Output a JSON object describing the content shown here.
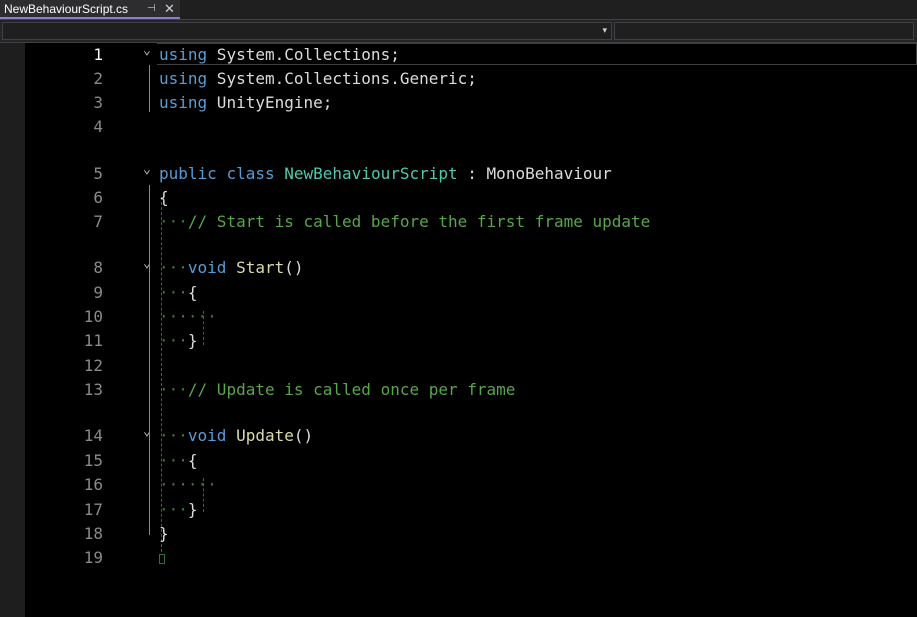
{
  "tab": {
    "title": "NewBehaviourScript.cs",
    "pin_glyph": "⊣",
    "close_glyph": "✕"
  },
  "navbar": {
    "chevron": "▾"
  },
  "fold_glyph": "⌄",
  "lines": [
    {
      "n": "1",
      "fold": true,
      "current": true
    },
    {
      "n": "2"
    },
    {
      "n": "3"
    },
    {
      "n": "4"
    },
    {
      "n": "5",
      "fold": true
    },
    {
      "n": "6"
    },
    {
      "n": "7"
    },
    {
      "n": "8",
      "fold": true
    },
    {
      "n": "9"
    },
    {
      "n": "10"
    },
    {
      "n": "11"
    },
    {
      "n": "12"
    },
    {
      "n": "13"
    },
    {
      "n": "14",
      "fold": true
    },
    {
      "n": "15"
    },
    {
      "n": "16"
    },
    {
      "n": "17"
    },
    {
      "n": "18"
    },
    {
      "n": "19"
    }
  ],
  "code": {
    "l1_kw": "using",
    "l1_rest": " System.Collections;",
    "l2_kw": "using",
    "l2_rest": " System.Collections.Generic;",
    "l3_kw": "using",
    "l3_rest": " UnityEngine;",
    "l5_kw1": "public",
    "l5_kw2": "class",
    "l5_cls": "NewBehaviourScript",
    "l5_colon": " : ",
    "l5_base": "MonoBehaviour",
    "l6": "{",
    "l7_ws": "···",
    "l7_cmt": "// Start is called before the first frame update",
    "l8_ws": "···",
    "l8_kw": "void",
    "l8_fn": " Start",
    "l8_paren": "()",
    "l9_ws": "···",
    "l9_brace": "{",
    "l10_ws": "······",
    "l11_ws": "···",
    "l11_brace": "}",
    "l13_ws": "···",
    "l13_cmt": "// Update is called once per frame",
    "l14_ws": "···",
    "l14_kw": "void",
    "l14_fn": " Update",
    "l14_paren": "()",
    "l15_ws": "···",
    "l15_brace": "{",
    "l16_ws": "······",
    "l17_ws": "···",
    "l17_brace": "}",
    "l18": "}"
  }
}
